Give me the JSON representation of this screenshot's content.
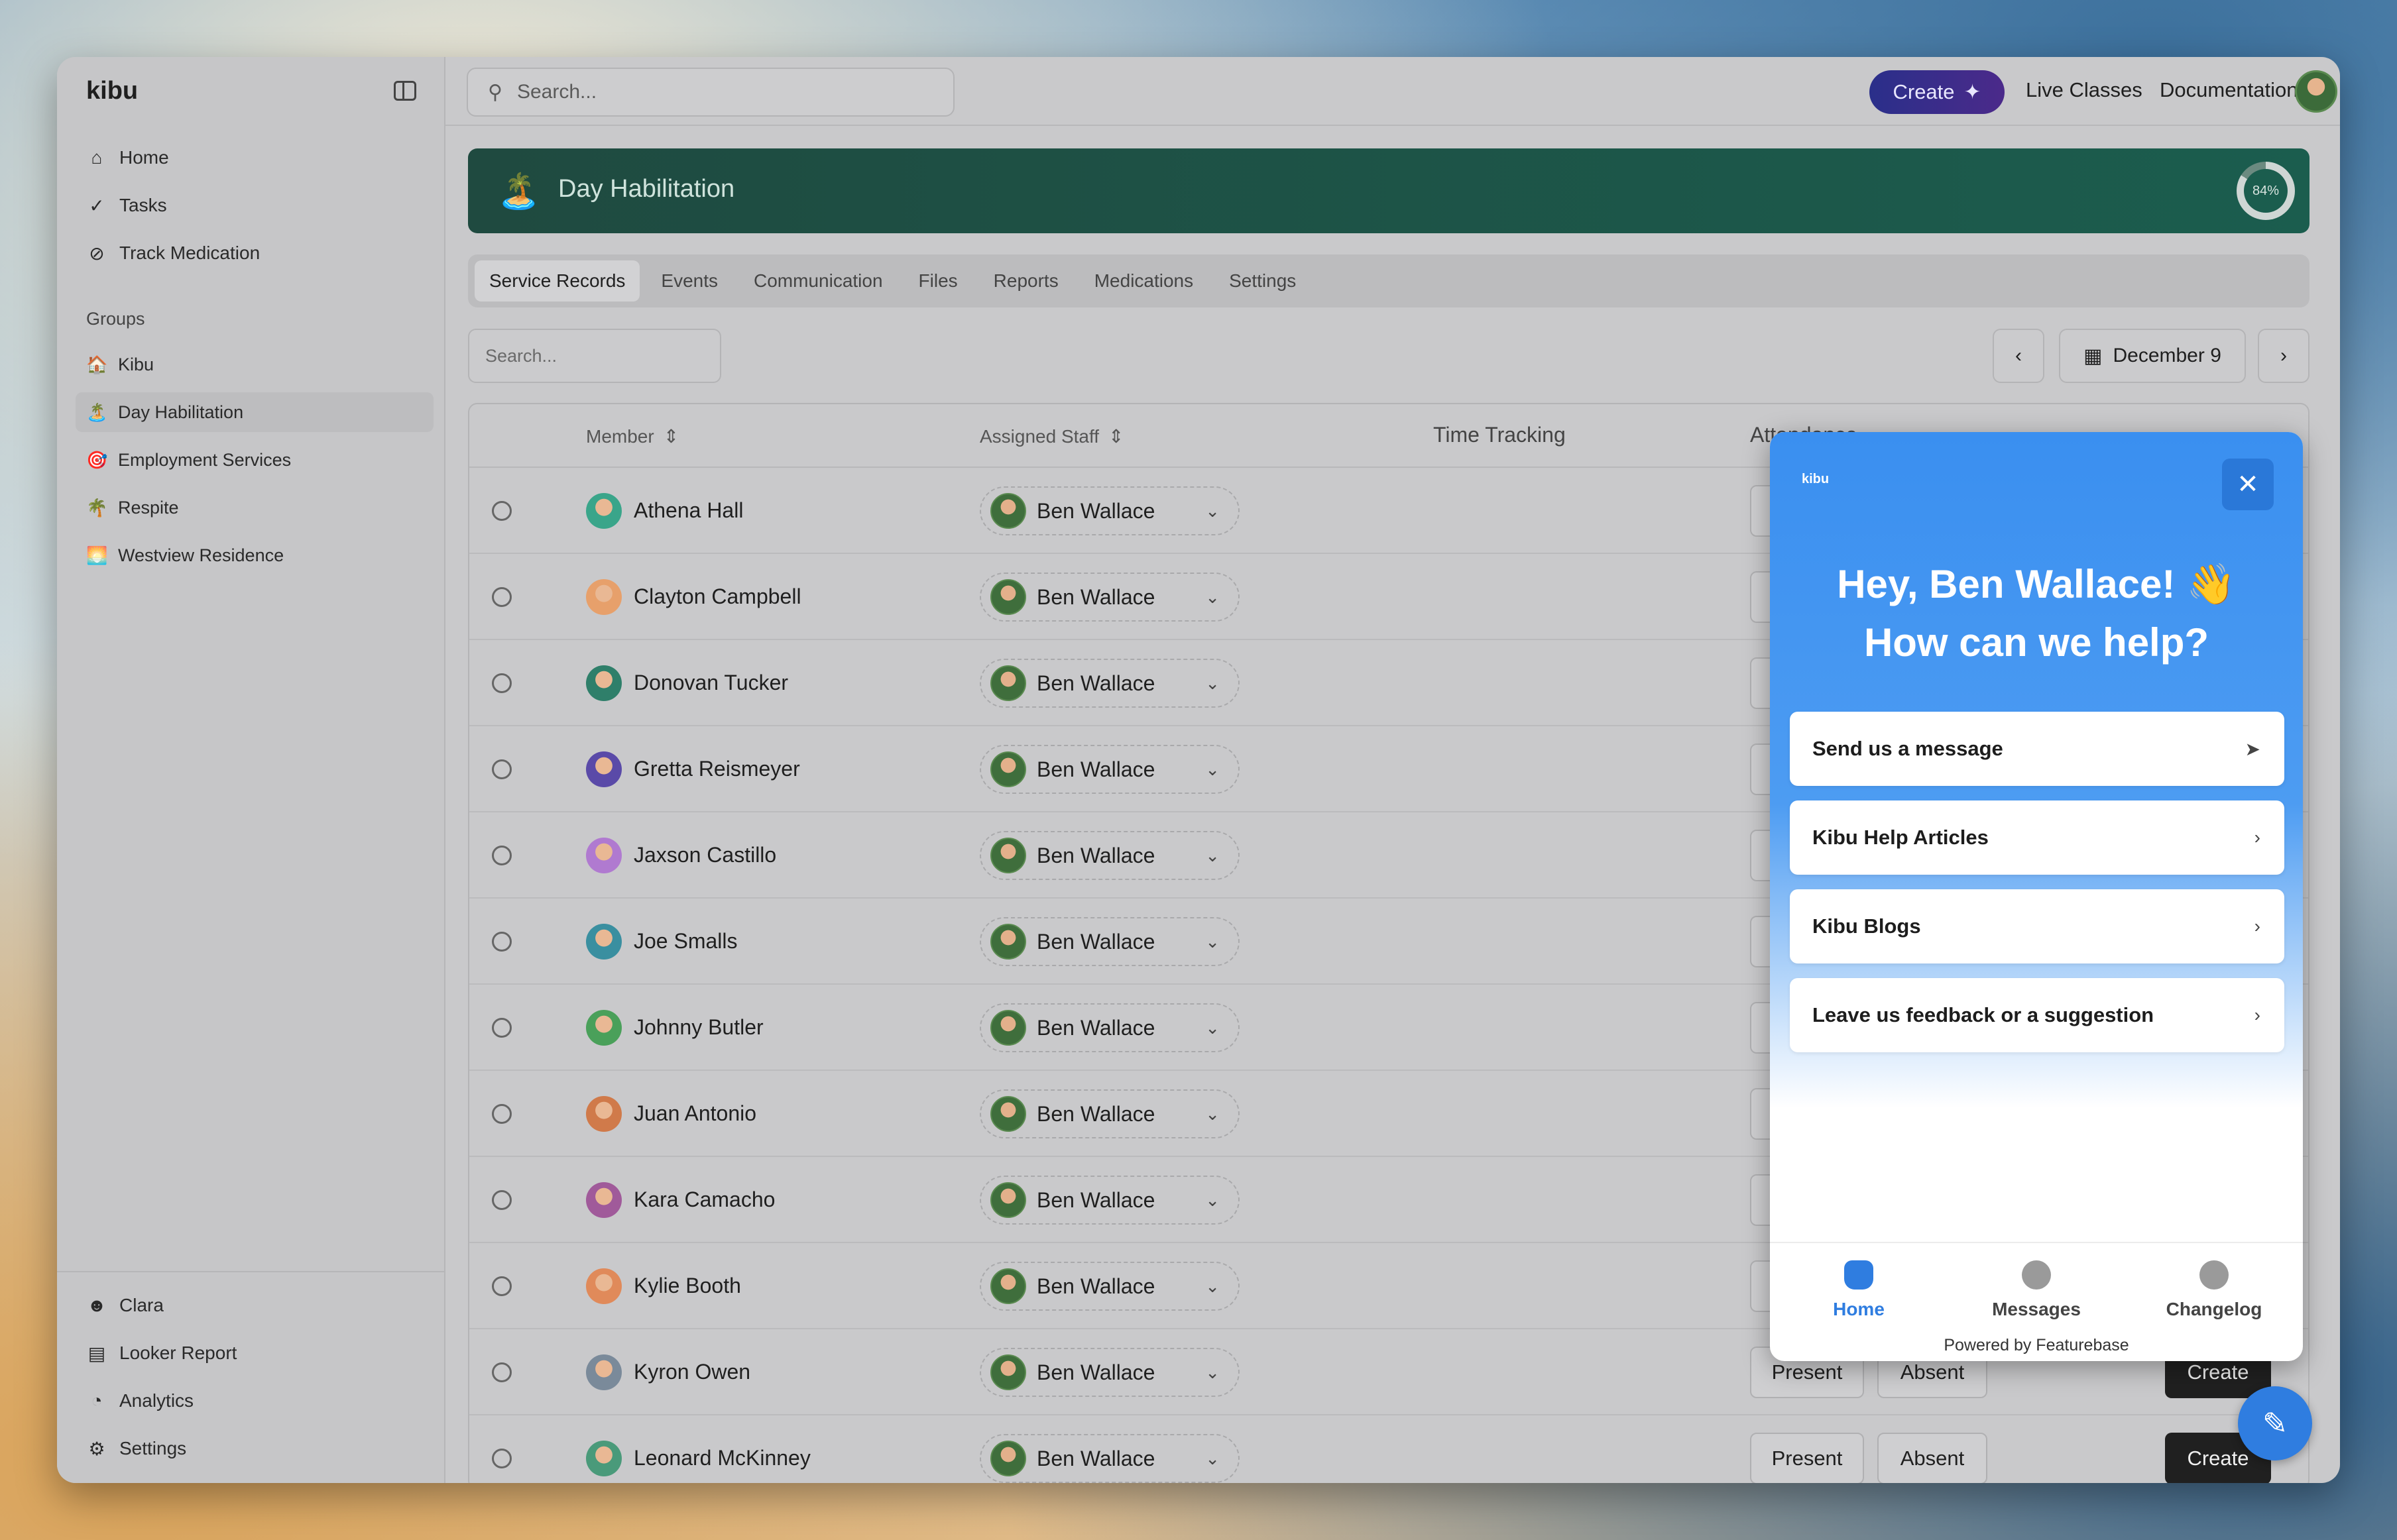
{
  "app": {
    "brand": "kibu"
  },
  "colors": {
    "accent": "#2f7de0",
    "banner": "#1b5d4e",
    "create_gradient": "#2a2f8a"
  },
  "sidebar": {
    "nav": [
      {
        "label": "Home",
        "icon": "home-icon"
      },
      {
        "label": "Tasks",
        "icon": "tasks-icon"
      },
      {
        "label": "Track Medication",
        "icon": "pill-icon"
      }
    ],
    "groups_label": "Groups",
    "groups": [
      {
        "label": "Kibu",
        "emoji": "🏠"
      },
      {
        "label": "Day Habilitation",
        "emoji": "🏝️",
        "active": true
      },
      {
        "label": "Employment Services",
        "emoji": "🎯"
      },
      {
        "label": "Respite",
        "emoji": "🌴"
      },
      {
        "label": "Westview Residence",
        "emoji": "🌅"
      }
    ],
    "bottom": [
      {
        "label": "Clara",
        "icon": "clara-icon"
      },
      {
        "label": "Looker Report",
        "icon": "document-icon"
      },
      {
        "label": "Analytics",
        "icon": "chart-pie-icon"
      },
      {
        "label": "Settings",
        "icon": "gear-icon"
      }
    ]
  },
  "topbar": {
    "search_placeholder": "Search...",
    "create_label": "Create",
    "live_classes": "Live Classes",
    "documentation": "Documentation"
  },
  "banner": {
    "title": "Day Habilitation",
    "emoji": "🏝️",
    "progress_label": "84%",
    "progress": 0.84
  },
  "tabs": [
    "Service Records",
    "Events",
    "Communication",
    "Files",
    "Reports",
    "Medications",
    "Settings"
  ],
  "active_tab": 0,
  "toolbar": {
    "search_placeholder": "Search...",
    "date": "December 9",
    "prev": "‹",
    "next": "›"
  },
  "table": {
    "headers": {
      "member": "Member",
      "staff": "Assigned Staff",
      "time": "Time Tracking",
      "attendance": "Attendance"
    },
    "rows": [
      {
        "member": "Athena Hall",
        "staff": "Ben Wallace",
        "avatar": "#3aa58a"
      },
      {
        "member": "Clayton Campbell",
        "staff": "Ben Wallace",
        "avatar": "#e7a06b"
      },
      {
        "member": "Donovan Tucker",
        "staff": "Ben Wallace",
        "avatar": "#2f7f6a"
      },
      {
        "member": "Gretta Reismeyer",
        "staff": "Ben Wallace",
        "avatar": "#5a4aa8"
      },
      {
        "member": "Jaxson Castillo",
        "staff": "Ben Wallace",
        "avatar": "#b07ad0"
      },
      {
        "member": "Joe Smalls",
        "staff": "Ben Wallace",
        "avatar": "#3a8fa0"
      },
      {
        "member": "Johnny Butler",
        "staff": "Ben Wallace",
        "avatar": "#4aa05a"
      },
      {
        "member": "Juan Antonio",
        "staff": "Ben Wallace",
        "avatar": "#d07a4a"
      },
      {
        "member": "Kara Camacho",
        "staff": "Ben Wallace",
        "avatar": "#a05a9a"
      },
      {
        "member": "Kylie Booth",
        "staff": "Ben Wallace",
        "avatar": "#e08a5a"
      },
      {
        "member": "Kyron Owen",
        "staff": "Ben Wallace",
        "avatar": "#7a8a9a"
      },
      {
        "member": "Leonard McKinney",
        "staff": "Ben Wallace",
        "avatar": "#4a9a7a"
      }
    ],
    "present_label": "Present",
    "absent_label": "Absent",
    "create_label": "Create"
  },
  "widget": {
    "logo": "kibu",
    "greeting_line1": "Hey, Ben Wallace! 👋",
    "greeting_line2": "How can we help?",
    "cards": [
      {
        "label": "Send us a message",
        "icon": "send-icon"
      },
      {
        "label": "Kibu Help Articles",
        "icon": "chevron-right-icon"
      },
      {
        "label": "Kibu Blogs",
        "icon": "chevron-right-icon"
      },
      {
        "label": "Leave us feedback or a suggestion",
        "icon": "chevron-right-icon"
      }
    ],
    "nav": [
      {
        "label": "Home",
        "active": true
      },
      {
        "label": "Messages"
      },
      {
        "label": "Changelog"
      }
    ],
    "powered": "Powered by Featurebase"
  }
}
